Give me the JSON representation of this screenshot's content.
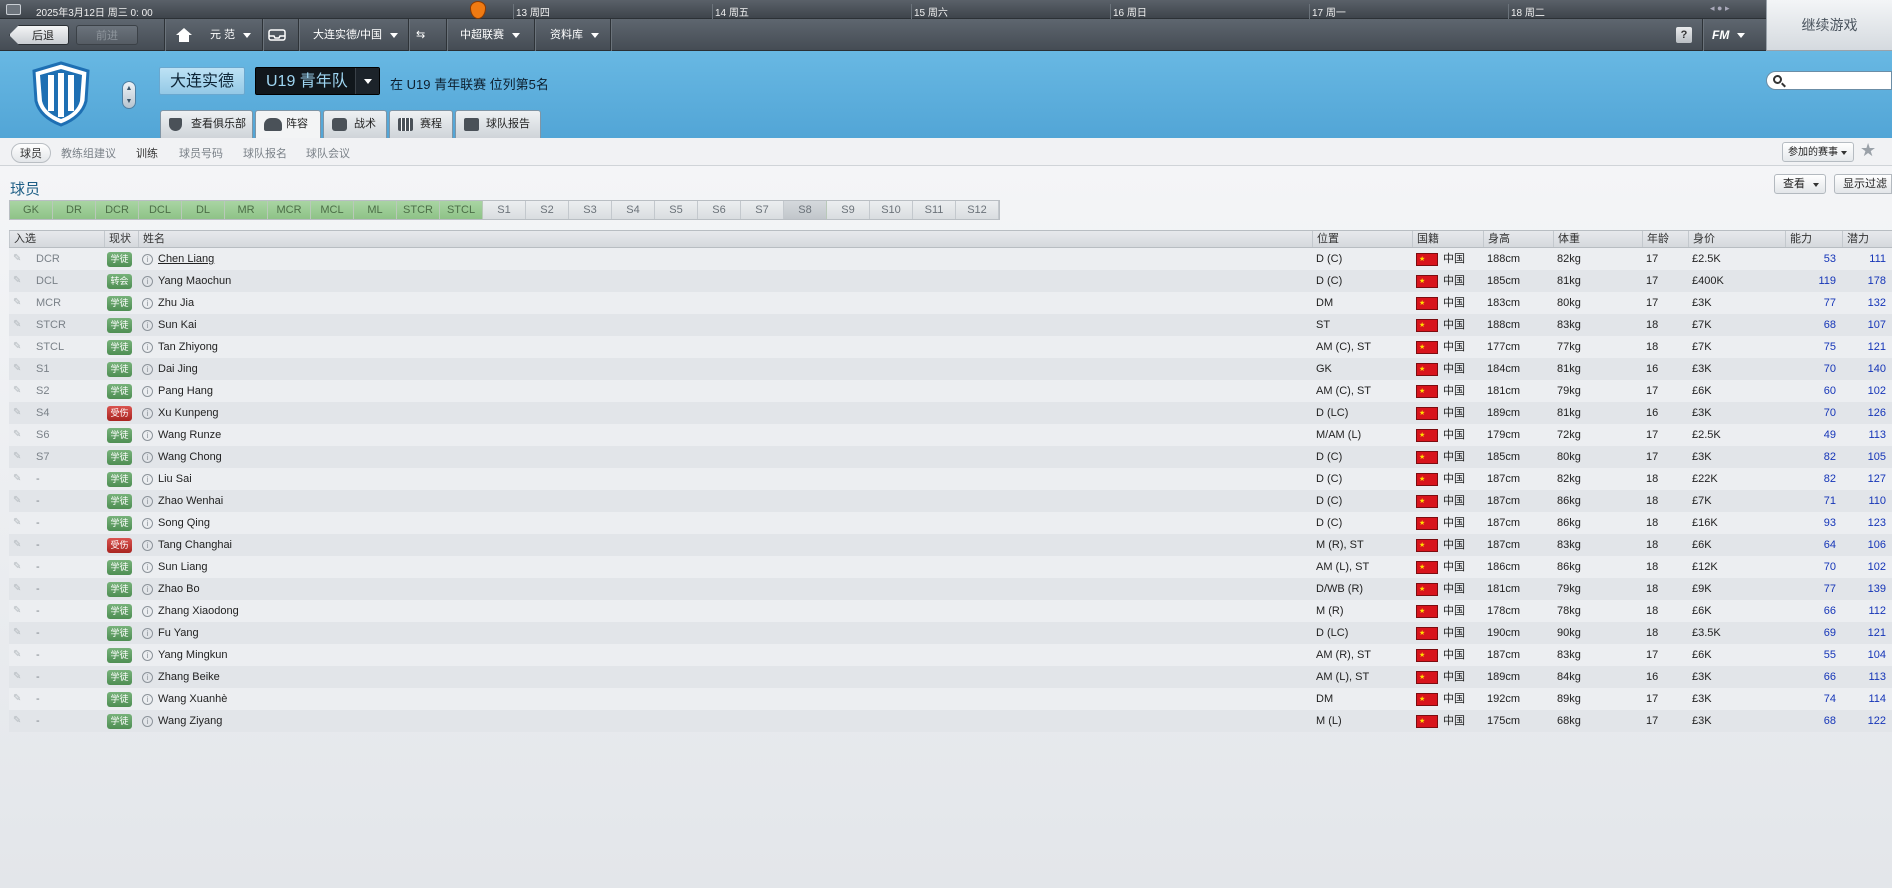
{
  "topbar": {
    "date": "2025年3月12日 周三 0: 00",
    "days": [
      "13 周四",
      "14 周五",
      "15 周六",
      "16 周日",
      "17 周一",
      "18 周二"
    ]
  },
  "nav": {
    "back": "后退",
    "forward": "前进",
    "manager": "元 范",
    "club": "大连实德/中国",
    "league": "中超联赛",
    "database": "资料库",
    "help": "?",
    "fm": "FM"
  },
  "continue": "继续游戏",
  "header": {
    "club_name": "大连实德",
    "squad": "U19 青年队",
    "league_position": "在 U19 青年联赛 位列第5名"
  },
  "tabs": [
    "查看俱乐部",
    "阵容",
    "战术",
    "赛程",
    "球队报告"
  ],
  "subnav": [
    "球员",
    "教练组建议",
    "训练",
    "球员号码",
    "球队报名",
    "球队会议"
  ],
  "competition_select": "参加的赛事",
  "section_title": "球员",
  "view_btn": "查看",
  "filter_btn": "显示过滤",
  "position_filters": [
    "GK",
    "DR",
    "DCR",
    "DCL",
    "DL",
    "MR",
    "MCR",
    "MCL",
    "ML",
    "STCR",
    "STCL",
    "S1",
    "S2",
    "S3",
    "S4",
    "S5",
    "S6",
    "S7",
    "S8",
    "S9",
    "S10",
    "S11",
    "S12"
  ],
  "columns": {
    "sel": "入选",
    "status": "现状",
    "name": "姓名",
    "pos": "位置",
    "nat": "国籍",
    "height": "身高",
    "weight": "体重",
    "age": "年龄",
    "value": "身价",
    "ca": "能力",
    "pa": "潜力"
  },
  "players": [
    {
      "slot": "DCR",
      "status": "学徒",
      "name": "Chen Liang",
      "pos": "D (C)",
      "nat": "中国",
      "height": "188cm",
      "weight": "82kg",
      "age": "17",
      "value": "£2.5K",
      "ca": "53",
      "pa": "111"
    },
    {
      "slot": "DCL",
      "status": "转会",
      "name": "Yang Maochun",
      "pos": "D (C)",
      "nat": "中国",
      "height": "185cm",
      "weight": "81kg",
      "age": "17",
      "value": "£400K",
      "ca": "119",
      "pa": "178"
    },
    {
      "slot": "MCR",
      "status": "学徒",
      "name": "Zhu Jia",
      "pos": "DM",
      "nat": "中国",
      "height": "183cm",
      "weight": "80kg",
      "age": "17",
      "value": "£3K",
      "ca": "77",
      "pa": "132"
    },
    {
      "slot": "STCR",
      "status": "学徒",
      "name": "Sun Kai",
      "pos": "ST",
      "nat": "中国",
      "height": "188cm",
      "weight": "83kg",
      "age": "18",
      "value": "£7K",
      "ca": "68",
      "pa": "107"
    },
    {
      "slot": "STCL",
      "status": "学徒",
      "name": "Tan Zhiyong",
      "pos": "AM (C), ST",
      "nat": "中国",
      "height": "177cm",
      "weight": "77kg",
      "age": "18",
      "value": "£7K",
      "ca": "75",
      "pa": "121"
    },
    {
      "slot": "S1",
      "status": "学徒",
      "name": "Dai Jing",
      "pos": "GK",
      "nat": "中国",
      "height": "184cm",
      "weight": "81kg",
      "age": "16",
      "value": "£3K",
      "ca": "70",
      "pa": "140"
    },
    {
      "slot": "S2",
      "status": "学徒",
      "name": "Pang Hang",
      "pos": "AM (C), ST",
      "nat": "中国",
      "height": "181cm",
      "weight": "79kg",
      "age": "17",
      "value": "£6K",
      "ca": "60",
      "pa": "102"
    },
    {
      "slot": "S4",
      "status": "受伤",
      "name": "Xu Kunpeng",
      "pos": "D (LC)",
      "nat": "中国",
      "height": "189cm",
      "weight": "81kg",
      "age": "16",
      "value": "£3K",
      "ca": "70",
      "pa": "126"
    },
    {
      "slot": "S6",
      "status": "学徒",
      "name": "Wang Runze",
      "pos": "M/AM (L)",
      "nat": "中国",
      "height": "179cm",
      "weight": "72kg",
      "age": "17",
      "value": "£2.5K",
      "ca": "49",
      "pa": "113"
    },
    {
      "slot": "S7",
      "status": "学徒",
      "name": "Wang Chong",
      "pos": "D (C)",
      "nat": "中国",
      "height": "185cm",
      "weight": "80kg",
      "age": "17",
      "value": "£3K",
      "ca": "82",
      "pa": "105"
    },
    {
      "slot": "-",
      "status": "学徒",
      "name": "Liu Sai",
      "pos": "D (C)",
      "nat": "中国",
      "height": "187cm",
      "weight": "82kg",
      "age": "18",
      "value": "£22K",
      "ca": "82",
      "pa": "127"
    },
    {
      "slot": "-",
      "status": "学徒",
      "name": "Zhao Wenhai",
      "pos": "D (C)",
      "nat": "中国",
      "height": "187cm",
      "weight": "86kg",
      "age": "18",
      "value": "£7K",
      "ca": "71",
      "pa": "110"
    },
    {
      "slot": "-",
      "status": "学徒",
      "name": "Song Qing",
      "pos": "D (C)",
      "nat": "中国",
      "height": "187cm",
      "weight": "86kg",
      "age": "18",
      "value": "£16K",
      "ca": "93",
      "pa": "123"
    },
    {
      "slot": "-",
      "status": "受伤",
      "name": "Tang Changhai",
      "pos": "M (R), ST",
      "nat": "中国",
      "height": "187cm",
      "weight": "83kg",
      "age": "18",
      "value": "£6K",
      "ca": "64",
      "pa": "106"
    },
    {
      "slot": "-",
      "status": "学徒",
      "name": "Sun Liang",
      "pos": "AM (L), ST",
      "nat": "中国",
      "height": "186cm",
      "weight": "86kg",
      "age": "18",
      "value": "£12K",
      "ca": "70",
      "pa": "102"
    },
    {
      "slot": "-",
      "status": "学徒",
      "name": "Zhao Bo",
      "pos": "D/WB (R)",
      "nat": "中国",
      "height": "181cm",
      "weight": "79kg",
      "age": "18",
      "value": "£9K",
      "ca": "77",
      "pa": "139"
    },
    {
      "slot": "-",
      "status": "学徒",
      "name": "Zhang Xiaodong",
      "pos": "M (R)",
      "nat": "中国",
      "height": "178cm",
      "weight": "78kg",
      "age": "18",
      "value": "£6K",
      "ca": "66",
      "pa": "112"
    },
    {
      "slot": "-",
      "status": "学徒",
      "name": "Fu Yang",
      "pos": "D (LC)",
      "nat": "中国",
      "height": "190cm",
      "weight": "90kg",
      "age": "18",
      "value": "£3.5K",
      "ca": "69",
      "pa": "121"
    },
    {
      "slot": "-",
      "status": "学徒",
      "name": "Yang Mingkun",
      "pos": "AM (R), ST",
      "nat": "中国",
      "height": "187cm",
      "weight": "83kg",
      "age": "17",
      "value": "£6K",
      "ca": "55",
      "pa": "104"
    },
    {
      "slot": "-",
      "status": "学徒",
      "name": "Zhang Beike",
      "pos": "AM (L), ST",
      "nat": "中国",
      "height": "189cm",
      "weight": "84kg",
      "age": "16",
      "value": "£3K",
      "ca": "66",
      "pa": "113"
    },
    {
      "slot": "-",
      "status": "学徒",
      "name": "Wang Xuanhè",
      "pos": "DM",
      "nat": "中国",
      "height": "192cm",
      "weight": "89kg",
      "age": "17",
      "value": "£3K",
      "ca": "74",
      "pa": "114"
    },
    {
      "slot": "-",
      "status": "学徒",
      "name": "Wang Ziyang",
      "pos": "M (L)",
      "nat": "中国",
      "height": "175cm",
      "weight": "68kg",
      "age": "17",
      "value": "£3K",
      "ca": "68",
      "pa": "122"
    }
  ]
}
